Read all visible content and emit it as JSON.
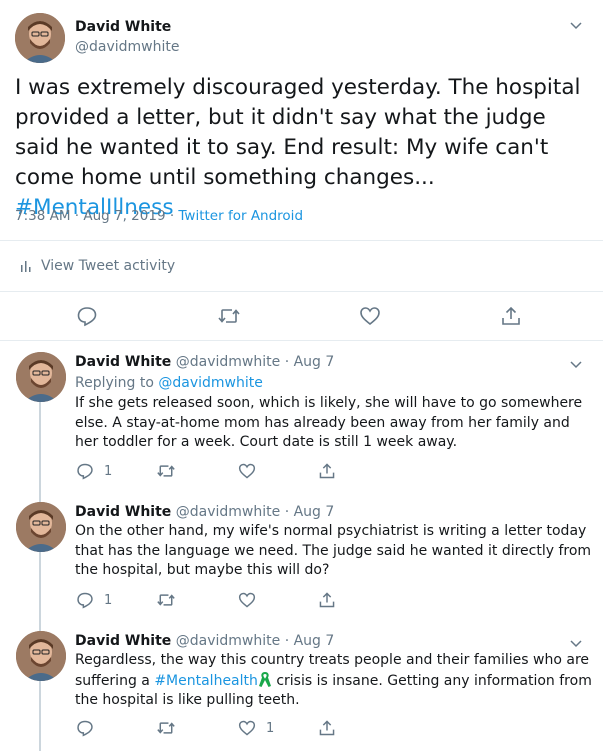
{
  "main_tweet": {
    "name": "David White",
    "handle": "@davidmwhite",
    "text": "I was extremely discouraged yesterday. The hospital provided a letter, but it didn't say what the judge said he wanted it to say. End result: My wife can't come home until something changes... ",
    "hashtag": "#MentalIllness",
    "time": "7:38 AM · Aug 7, 2019 · ",
    "source": "Twitter for Android",
    "activity_label": "View Tweet activity"
  },
  "replies": [
    {
      "name": "David White",
      "handle": "@davidmwhite",
      "sep": "·",
      "date": "Aug 7",
      "replying_prefix": "Replying to ",
      "replying_handle": "@davidmwhite",
      "text": "If she gets released soon, which is likely, she will have to go somewhere else. A stay-at-home mom has already been away from her family and her toddler for a week. Court date is still 1 week away.",
      "reply_count": "1",
      "like_count": ""
    },
    {
      "name": "David White",
      "handle": "@davidmwhite",
      "sep": "·",
      "date": "Aug 7",
      "text": "On the other hand, my wife's normal psychiatrist is writing a letter today that has the language we need. The judge said he wanted it directly from the hospital, but maybe this will do?",
      "reply_count": "1",
      "like_count": ""
    },
    {
      "name": "David White",
      "handle": "@davidmwhite",
      "sep": "·",
      "date": "Aug 7",
      "text_before": "Regardless, the way this country treats people and their families who are suffering a ",
      "hashtag": "#Mentalhealth",
      "text_after": " crisis is insane. Getting any information from the hospital is like pulling teeth.",
      "reply_count": "",
      "like_count": "1"
    }
  ],
  "colors": {
    "link": "#1b95e0",
    "muted": "#657786",
    "text": "#14171a",
    "ribbon": "#19a84a"
  }
}
